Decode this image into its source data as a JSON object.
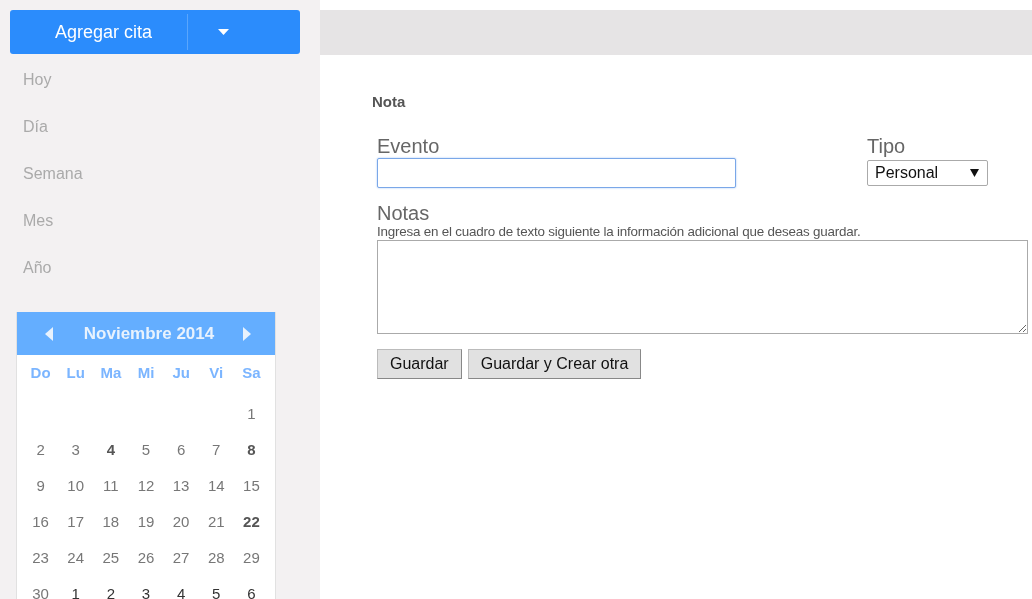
{
  "sidebar": {
    "add_button": {
      "label": "Agregar cita"
    },
    "nav": [
      {
        "label": "Hoy"
      },
      {
        "label": "Día"
      },
      {
        "label": "Semana"
      },
      {
        "label": "Mes"
      },
      {
        "label": "Año"
      }
    ],
    "calendar": {
      "title": "Noviembre 2014",
      "weekdays": [
        "Do",
        "Lu",
        "Ma",
        "Mi",
        "Ju",
        "Vi",
        "Sa"
      ],
      "weeks": [
        [
          {
            "day": "1",
            "marked": false,
            "other_month": false
          }
        ],
        [
          {
            "day": "2",
            "marked": false,
            "other_month": false
          },
          {
            "day": "3",
            "marked": false,
            "other_month": false
          },
          {
            "day": "4",
            "marked": true,
            "other_month": false
          },
          {
            "day": "5",
            "marked": false,
            "other_month": false
          },
          {
            "day": "6",
            "marked": false,
            "other_month": false
          },
          {
            "day": "7",
            "marked": false,
            "other_month": false
          },
          {
            "day": "8",
            "marked": true,
            "other_month": false
          }
        ],
        [
          {
            "day": "9",
            "marked": false,
            "other_month": false
          },
          {
            "day": "10",
            "marked": false,
            "other_month": false
          },
          {
            "day": "11",
            "marked": false,
            "other_month": false
          },
          {
            "day": "12",
            "marked": false,
            "other_month": false
          },
          {
            "day": "13",
            "marked": false,
            "other_month": false
          },
          {
            "day": "14",
            "marked": false,
            "other_month": false
          },
          {
            "day": "15",
            "marked": false,
            "other_month": false
          }
        ],
        [
          {
            "day": "16",
            "marked": false,
            "other_month": false
          },
          {
            "day": "17",
            "marked": false,
            "other_month": false
          },
          {
            "day": "18",
            "marked": false,
            "other_month": false
          },
          {
            "day": "19",
            "marked": false,
            "other_month": false
          },
          {
            "day": "20",
            "marked": false,
            "other_month": false
          },
          {
            "day": "21",
            "marked": false,
            "other_month": false
          },
          {
            "day": "22",
            "marked": true,
            "other_month": false
          }
        ],
        [
          {
            "day": "23",
            "marked": false,
            "other_month": false
          },
          {
            "day": "24",
            "marked": false,
            "other_month": false
          },
          {
            "day": "25",
            "marked": false,
            "other_month": false
          },
          {
            "day": "26",
            "marked": false,
            "other_month": false
          },
          {
            "day": "27",
            "marked": false,
            "other_month": false
          },
          {
            "day": "28",
            "marked": false,
            "other_month": false
          },
          {
            "day": "29",
            "marked": false,
            "other_month": false
          }
        ],
        [
          {
            "day": "30",
            "marked": false,
            "other_month": false
          },
          {
            "day": "1",
            "marked": false,
            "other_month": true
          },
          {
            "day": "2",
            "marked": false,
            "other_month": true
          },
          {
            "day": "3",
            "marked": false,
            "other_month": true
          },
          {
            "day": "4",
            "marked": false,
            "other_month": true
          },
          {
            "day": "5",
            "marked": false,
            "other_month": true
          },
          {
            "day": "6",
            "marked": false,
            "other_month": true
          }
        ]
      ]
    }
  },
  "form": {
    "title": "Nota",
    "event": {
      "label": "Evento",
      "focused": true
    },
    "type": {
      "label": "Tipo",
      "value": "Personal"
    },
    "notes": {
      "label": "Notas",
      "hint": "Ingresa en el cuadro de texto siguiente la información adicional que deseas guardar."
    },
    "buttons": [
      "Guardar",
      "Guardar y Crear otra"
    ]
  }
}
